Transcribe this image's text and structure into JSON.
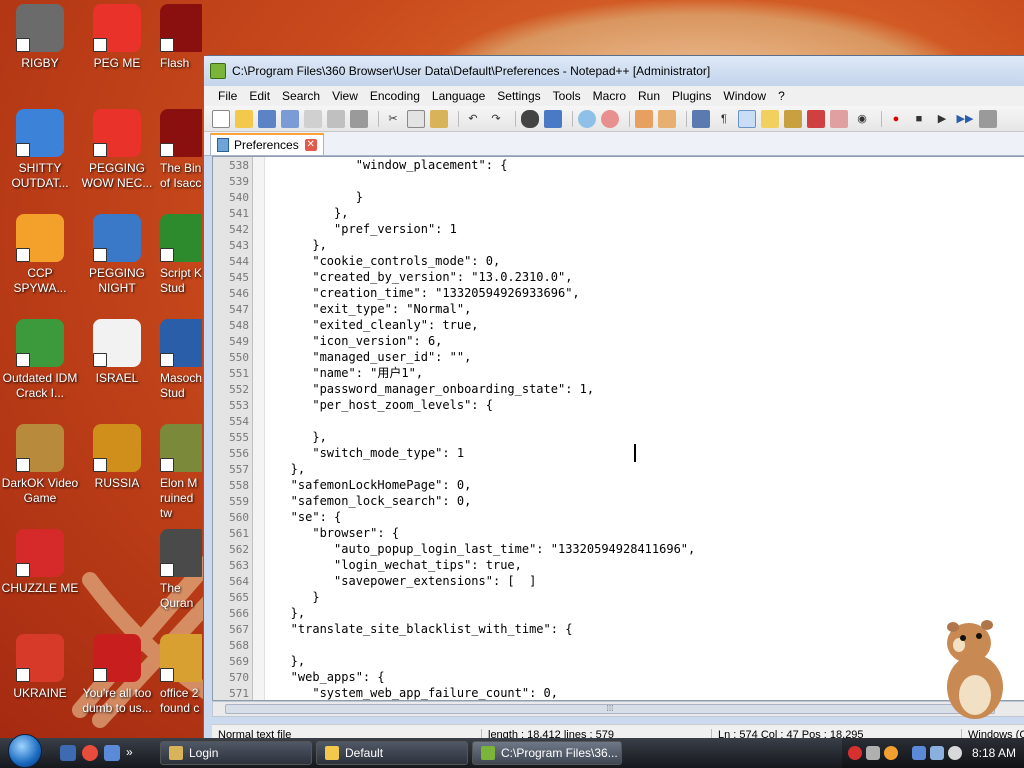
{
  "desktop": {
    "icons": [
      {
        "label": "RIGBY",
        "color": "#6b6b6b"
      },
      {
        "label": "PEG ME",
        "color": "#e8322a"
      },
      {
        "label": "Flash",
        "color": "#8a1010"
      },
      {
        "label": "SHITTY OUTDAT...",
        "color": "#3b82d8"
      },
      {
        "label": "PEGGING WOW NEC...",
        "color": "#e8322a"
      },
      {
        "label": "The Bin of Isacc",
        "color": "#8a1010"
      },
      {
        "label": "CCP SPYWA...",
        "color": "#f4a12c"
      },
      {
        "label": "PEGGING NIGHT",
        "color": "#3a78c8"
      },
      {
        "label": "Script K Stud",
        "color": "#2d8a2d"
      },
      {
        "label": "Outdated IDM Crack I...",
        "color": "#3c9a3c"
      },
      {
        "label": "ISRAEL",
        "color": "#f2f2f2"
      },
      {
        "label": "Masoch Stud",
        "color": "#2a5ea8"
      },
      {
        "label": "DarkOK Video Game",
        "color": "#b78a3c"
      },
      {
        "label": "RUSSIA",
        "color": "#d08f1a"
      },
      {
        "label": "Elon M ruined tw",
        "color": "#7a8a3a"
      },
      {
        "label": "CHUZZLE ME",
        "color": "#d62a2a"
      },
      {
        "label": "The Quran",
        "color": "#4a4a4a"
      },
      {
        "label": "UKRAINE",
        "color": "#d83a2a"
      },
      {
        "label": "You're all too dumb to us...",
        "color": "#c81e1e"
      },
      {
        "label": "office 2 found c",
        "color": "#d8a030"
      }
    ]
  },
  "window": {
    "title": "C:\\Program Files\\360 Browser\\User Data\\Default\\Preferences - Notepad++ [Administrator]",
    "menu": [
      "File",
      "Edit",
      "Search",
      "View",
      "Encoding",
      "Language",
      "Settings",
      "Tools",
      "Macro",
      "Run",
      "Plugins",
      "Window",
      "?"
    ],
    "tab_label": "Preferences",
    "close_glyph": "✕",
    "lines": [
      {
        "n": "538",
        "text": "            \"window_placement\": {"
      },
      {
        "n": "539",
        "text": ""
      },
      {
        "n": "540",
        "text": "            }"
      },
      {
        "n": "541",
        "text": "         },"
      },
      {
        "n": "542",
        "text": "         \"pref_version\": 1"
      },
      {
        "n": "543",
        "text": "      },"
      },
      {
        "n": "544",
        "text": "      \"cookie_controls_mode\": 0,"
      },
      {
        "n": "545",
        "text": "      \"created_by_version\": \"13.0.2310.0\","
      },
      {
        "n": "546",
        "text": "      \"creation_time\": \"13320594926933696\","
      },
      {
        "n": "547",
        "text": "      \"exit_type\": \"Normal\","
      },
      {
        "n": "548",
        "text": "      \"exited_cleanly\": true,"
      },
      {
        "n": "549",
        "text": "      \"icon_version\": 6,"
      },
      {
        "n": "550",
        "text": "      \"managed_user_id\": \"\","
      },
      {
        "n": "551",
        "text": "      \"name\": \"用户1\","
      },
      {
        "n": "552",
        "text": "      \"password_manager_onboarding_state\": 1,"
      },
      {
        "n": "553",
        "text": "      \"per_host_zoom_levels\": {"
      },
      {
        "n": "554",
        "text": ""
      },
      {
        "n": "555",
        "text": "      },"
      },
      {
        "n": "556",
        "text": "      \"switch_mode_type\": 1"
      },
      {
        "n": "557",
        "text": "   },"
      },
      {
        "n": "558",
        "text": "   \"safemonLockHomePage\": 0,"
      },
      {
        "n": "559",
        "text": "   \"safemon_lock_search\": 0,"
      },
      {
        "n": "560",
        "text": "   \"se\": {"
      },
      {
        "n": "561",
        "text": "      \"browser\": {"
      },
      {
        "n": "562",
        "text": "         \"auto_popup_login_last_time\": \"13320594928411696\","
      },
      {
        "n": "563",
        "text": "         \"login_wechat_tips\": true,"
      },
      {
        "n": "564",
        "text": "         \"savepower_extensions\": [  ]"
      },
      {
        "n": "565",
        "text": "      }"
      },
      {
        "n": "566",
        "text": "   },"
      },
      {
        "n": "567",
        "text": "   \"translate_site_blacklist_with_time\": {"
      },
      {
        "n": "568",
        "text": ""
      },
      {
        "n": "569",
        "text": "   },"
      },
      {
        "n": "570",
        "text": "   \"web_apps\": {"
      },
      {
        "n": "571",
        "text": "      \"system_web_app_failure_count\": 0,"
      }
    ],
    "status": {
      "type": "Normal text file",
      "length": "length : 18,412    lines : 579",
      "position": "Ln : 574    Col : 47    Pos : 18,295",
      "eol": "Windows (C"
    }
  },
  "taskbar": {
    "tasks": [
      "Login",
      "Default",
      "C:\\Program Files\\36..."
    ],
    "clock": "8:18 AM"
  }
}
